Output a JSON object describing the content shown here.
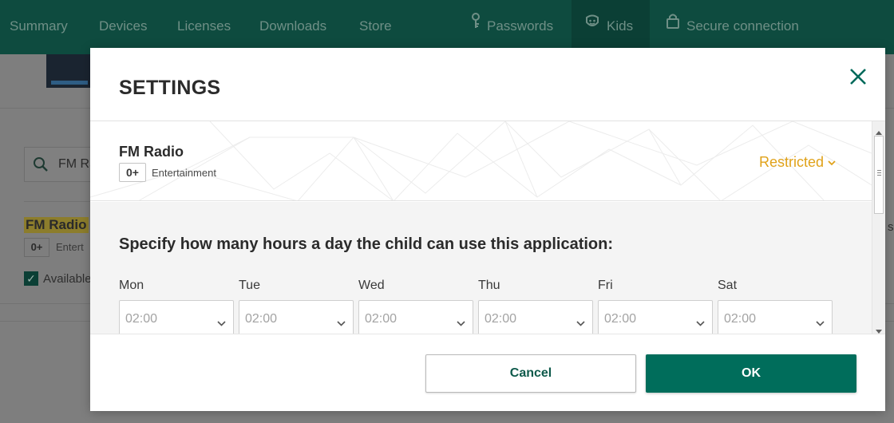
{
  "topnav": {
    "items": [
      {
        "label": "Summary",
        "icon": ""
      },
      {
        "label": "Devices",
        "icon": ""
      },
      {
        "label": "Licenses",
        "icon": ""
      },
      {
        "label": "Downloads",
        "icon": ""
      },
      {
        "label": "Store",
        "icon": ""
      },
      {
        "label": "Passwords",
        "icon": "key-icon"
      },
      {
        "label": "Kids",
        "icon": "kids-icon"
      },
      {
        "label": "Secure connection",
        "icon": "lock-icon"
      }
    ],
    "active": "Kids",
    "bg_color": "#0e4b3f"
  },
  "background": {
    "search_value": "FM Ra",
    "app_name": "FM Radio",
    "age": "0+",
    "category": "Entert",
    "available_label": "Available",
    "right_fragment": "s"
  },
  "modal": {
    "title": "SETTINGS",
    "close_icon": "close-icon",
    "app": {
      "name": "FM Radio",
      "age": "0+",
      "category": "Entertainment",
      "status": "Restricted",
      "status_color": "#e0a21a"
    },
    "limits": {
      "title": "Specify how many hours a day the child can use this application:",
      "days": [
        {
          "label": "Mon",
          "value": "02:00"
        },
        {
          "label": "Tue",
          "value": "02:00"
        },
        {
          "label": "Wed",
          "value": "02:00"
        },
        {
          "label": "Thu",
          "value": "02:00"
        },
        {
          "label": "Fri",
          "value": "02:00"
        },
        {
          "label": "Sat",
          "value": "02:00"
        }
      ]
    },
    "footer": {
      "cancel_label": "Cancel",
      "ok_label": "OK",
      "ok_color": "#006d5b"
    }
  }
}
